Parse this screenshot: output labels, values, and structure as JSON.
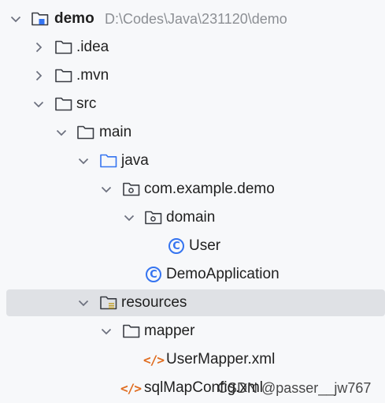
{
  "tree": {
    "root": {
      "label": "demo",
      "path": "D:\\Codes\\Java\\231120\\demo",
      "icon": "module-folder-icon"
    },
    "idea": {
      "label": ".idea",
      "icon": "folder-icon"
    },
    "mvn": {
      "label": ".mvn",
      "icon": "folder-icon"
    },
    "src": {
      "label": "src",
      "icon": "folder-icon"
    },
    "main": {
      "label": "main",
      "icon": "folder-icon"
    },
    "java": {
      "label": "java",
      "icon": "source-root-folder-icon"
    },
    "package": {
      "label": "com.example.demo",
      "icon": "package-icon"
    },
    "domain": {
      "label": "domain",
      "icon": "package-icon"
    },
    "user": {
      "label": "User",
      "icon": "java-class-icon"
    },
    "demoapp": {
      "label": "DemoApplication",
      "icon": "java-class-icon"
    },
    "resources": {
      "label": "resources",
      "icon": "resources-folder-icon"
    },
    "mapper": {
      "label": "mapper",
      "icon": "folder-icon"
    },
    "usermapper": {
      "label": "UserMapper.xml",
      "icon": "xml-file-icon"
    },
    "sqlmap": {
      "label": "sqlMapConfig.xml",
      "icon": "xml-file-icon"
    }
  },
  "watermark": "CSDN @passer__jw767",
  "colors": {
    "accent": "#3574f0",
    "selection": "#dfe1e5",
    "xml": "#e06c1f",
    "path": "#8c8f94"
  }
}
